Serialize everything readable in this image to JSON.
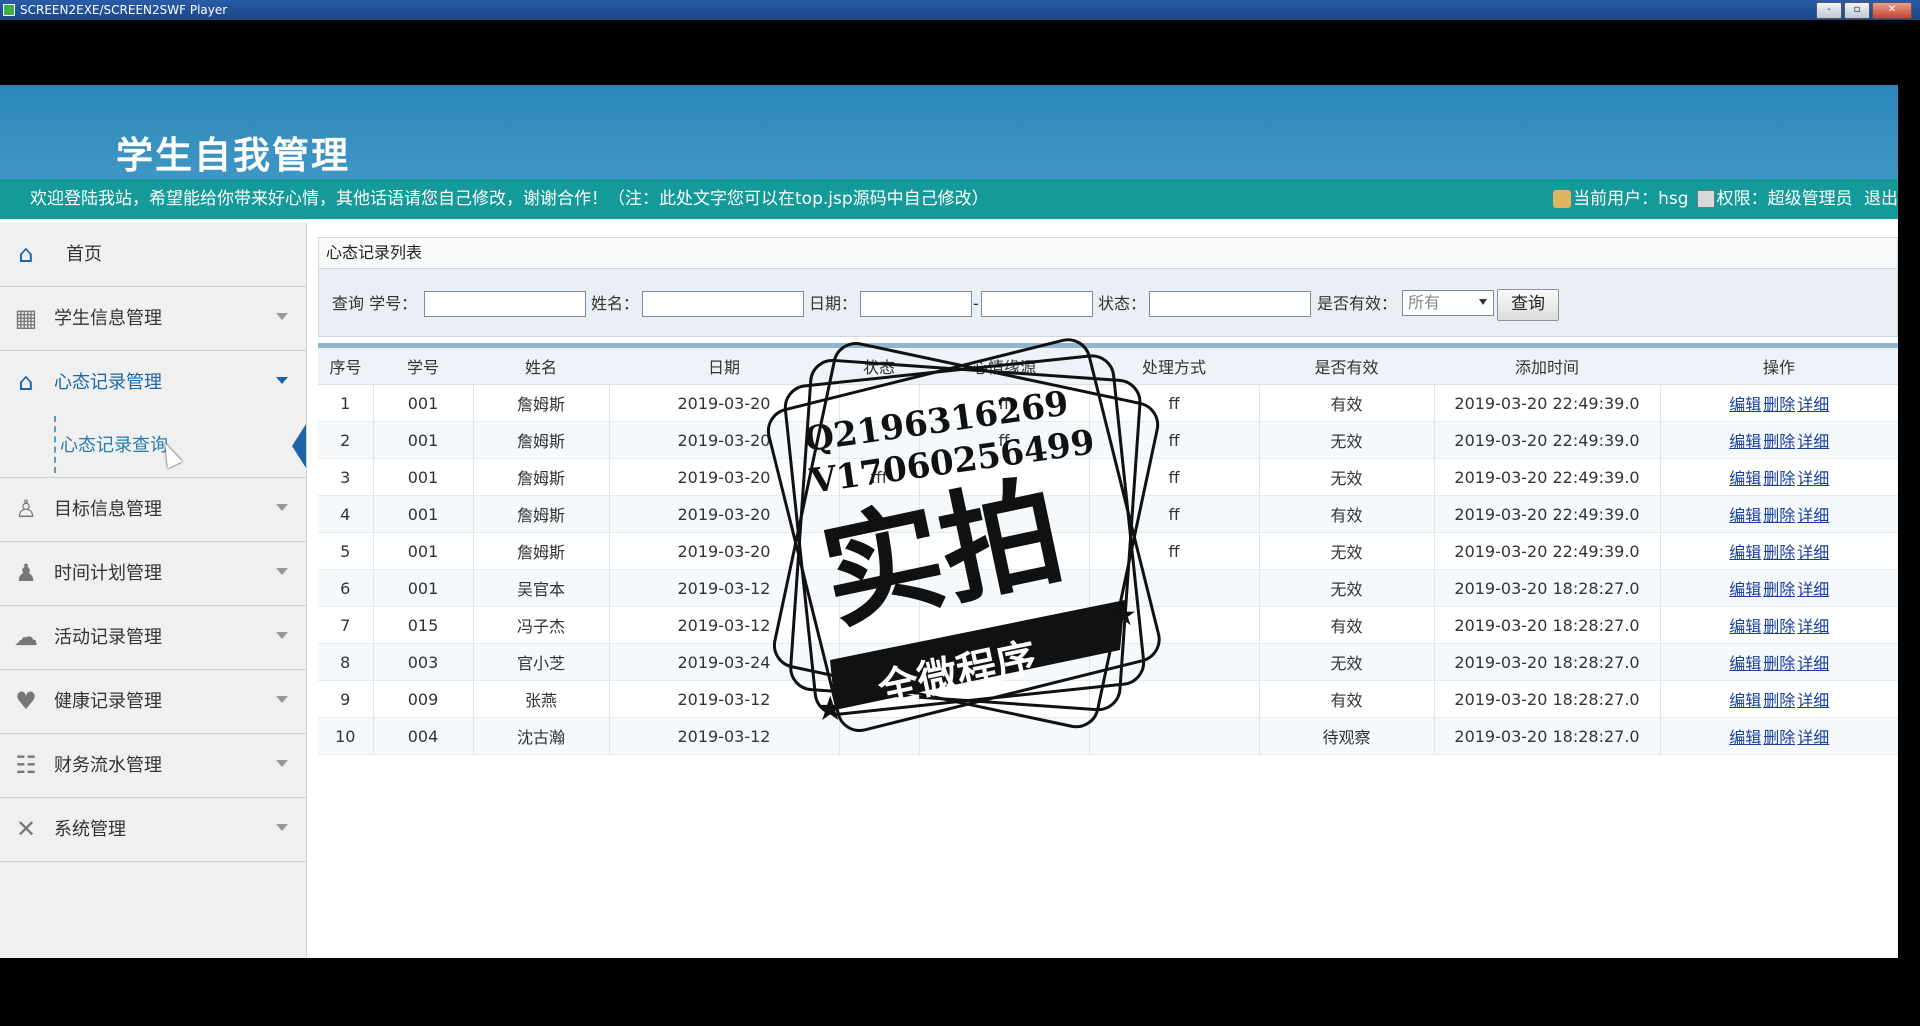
{
  "window": {
    "title": "SCREEN2EXE/SCREEN2SWF Player",
    "buttons": [
      "-",
      "▫",
      "✕"
    ]
  },
  "header": {
    "system_title": "学生自我管理"
  },
  "welcome_bar": {
    "message": "欢迎登陆我站，希望能给你带来好心情，其他话语请您自己修改，谢谢合作！（注：此处文字您可以在top.jsp源码中自己修改）",
    "current_user_text": "当前用户：hsg",
    "permission_text": "权限：超级管理员",
    "logout": "退出"
  },
  "sidebar": {
    "home": "首页",
    "items": [
      {
        "label": "学生信息管理",
        "icon": "grid-icon"
      },
      {
        "label": "心态记录管理",
        "icon": "home-icon",
        "active": true
      },
      {
        "label": "心态记录查询",
        "submenu": true
      },
      {
        "label": "目标信息管理",
        "icon": "people-icon"
      },
      {
        "label": "时间计划管理",
        "icon": "person-icon"
      },
      {
        "label": "活动记录管理",
        "icon": "chat-icon"
      },
      {
        "label": "健康记录管理",
        "icon": "heart-icon"
      },
      {
        "label": "财务流水管理",
        "icon": "group-icon"
      },
      {
        "label": "系统管理",
        "icon": "tools-icon"
      }
    ]
  },
  "panel": {
    "title": "心态记录列表"
  },
  "query": {
    "label_query_xuehao": "查询 学号：",
    "label_name": "姓名：",
    "label_date": "日期：",
    "date_sep": "-",
    "label_status": "状态：",
    "label_valid": "是否有效：",
    "valid_selected": "所有",
    "button": "查询"
  },
  "table": {
    "headers": [
      "序号",
      "学号",
      "姓名",
      "日期",
      "状态",
      "心情缘源",
      "处理方式",
      "是否有效",
      "添加时间",
      "操作"
    ],
    "ops": [
      "编辑",
      "删除",
      "详细"
    ],
    "rows": [
      [
        "1",
        "001",
        "詹姆斯",
        "2019-03-20",
        "",
        "ff",
        "ff",
        "有效",
        "2019-03-20 22:49:39.0"
      ],
      [
        "2",
        "001",
        "詹姆斯",
        "2019-03-20",
        "",
        "ff",
        "ff",
        "无效",
        "2019-03-20 22:49:39.0"
      ],
      [
        "3",
        "001",
        "詹姆斯",
        "2019-03-20",
        "fff",
        "",
        "ff",
        "无效",
        "2019-03-20 22:49:39.0"
      ],
      [
        "4",
        "001",
        "詹姆斯",
        "2019-03-20",
        "",
        "",
        "ff",
        "有效",
        "2019-03-20 22:49:39.0"
      ],
      [
        "5",
        "001",
        "詹姆斯",
        "2019-03-20",
        "",
        "",
        "ff",
        "无效",
        "2019-03-20 22:49:39.0"
      ],
      [
        "6",
        "001",
        "吴官本",
        "2019-03-12",
        "",
        "",
        "",
        "无效",
        "2019-03-20 18:28:27.0"
      ],
      [
        "7",
        "015",
        "冯子杰",
        "2019-03-12",
        "",
        "",
        "",
        "有效",
        "2019-03-20 18:28:27.0"
      ],
      [
        "8",
        "003",
        "官小芝",
        "2019-03-24",
        "",
        "",
        "",
        "无效",
        "2019-03-20 18:28:27.0"
      ],
      [
        "9",
        "009",
        "张燕",
        "2019-03-12",
        "",
        "",
        "",
        "有效",
        "2019-03-20 18:28:27.0"
      ],
      [
        "10",
        "004",
        "沈古瀚",
        "2019-03-12",
        "",
        "",
        "",
        "待观察",
        "2019-03-20 18:28:27.0"
      ]
    ]
  },
  "watermark": {
    "line1": "Q2196316269",
    "line2": "V17060256499",
    "big": "实拍",
    "banner": "全微程序"
  }
}
